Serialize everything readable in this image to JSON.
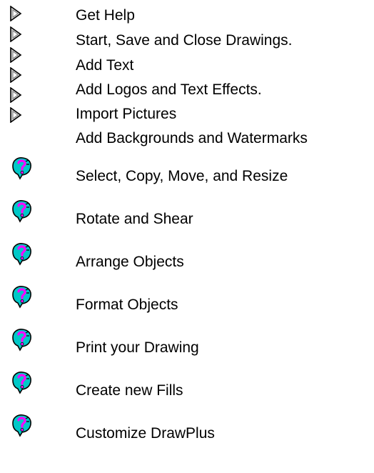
{
  "topics_with_arrow": [
    {
      "label": "Get Help",
      "icon": "arrow-pointer-icon"
    },
    {
      "label": "Start, Save and Close Drawings.",
      "icon": "arrow-pointer-icon"
    },
    {
      "label": "Add Text",
      "icon": "arrow-pointer-icon"
    },
    {
      "label": "Add Logos and Text Effects.",
      "icon": "arrow-pointer-icon"
    },
    {
      "label": "Import Pictures",
      "icon": "arrow-pointer-icon"
    },
    {
      "label": "Add Backgrounds and Watermarks",
      "icon": "arrow-pointer-icon"
    }
  ],
  "topics_with_help": [
    {
      "label": "Select, Copy, Move, and Resize",
      "icon": "help-question-icon"
    },
    {
      "label": "Rotate and Shear",
      "icon": "help-question-icon"
    },
    {
      "label": "Arrange Objects",
      "icon": "help-question-icon"
    },
    {
      "label": "Format Objects",
      "icon": "help-question-icon"
    },
    {
      "label": "Print your Drawing",
      "icon": "help-question-icon"
    },
    {
      "label": "Create new Fills",
      "icon": "help-question-icon"
    },
    {
      "label": "Customize DrawPlus",
      "icon": "help-question-icon"
    }
  ],
  "colors": {
    "arrow_fill": "#d0d0d0",
    "arrow_outline": "#000000",
    "help_body": "#00c8c8",
    "help_mark": "#ff00ff"
  }
}
